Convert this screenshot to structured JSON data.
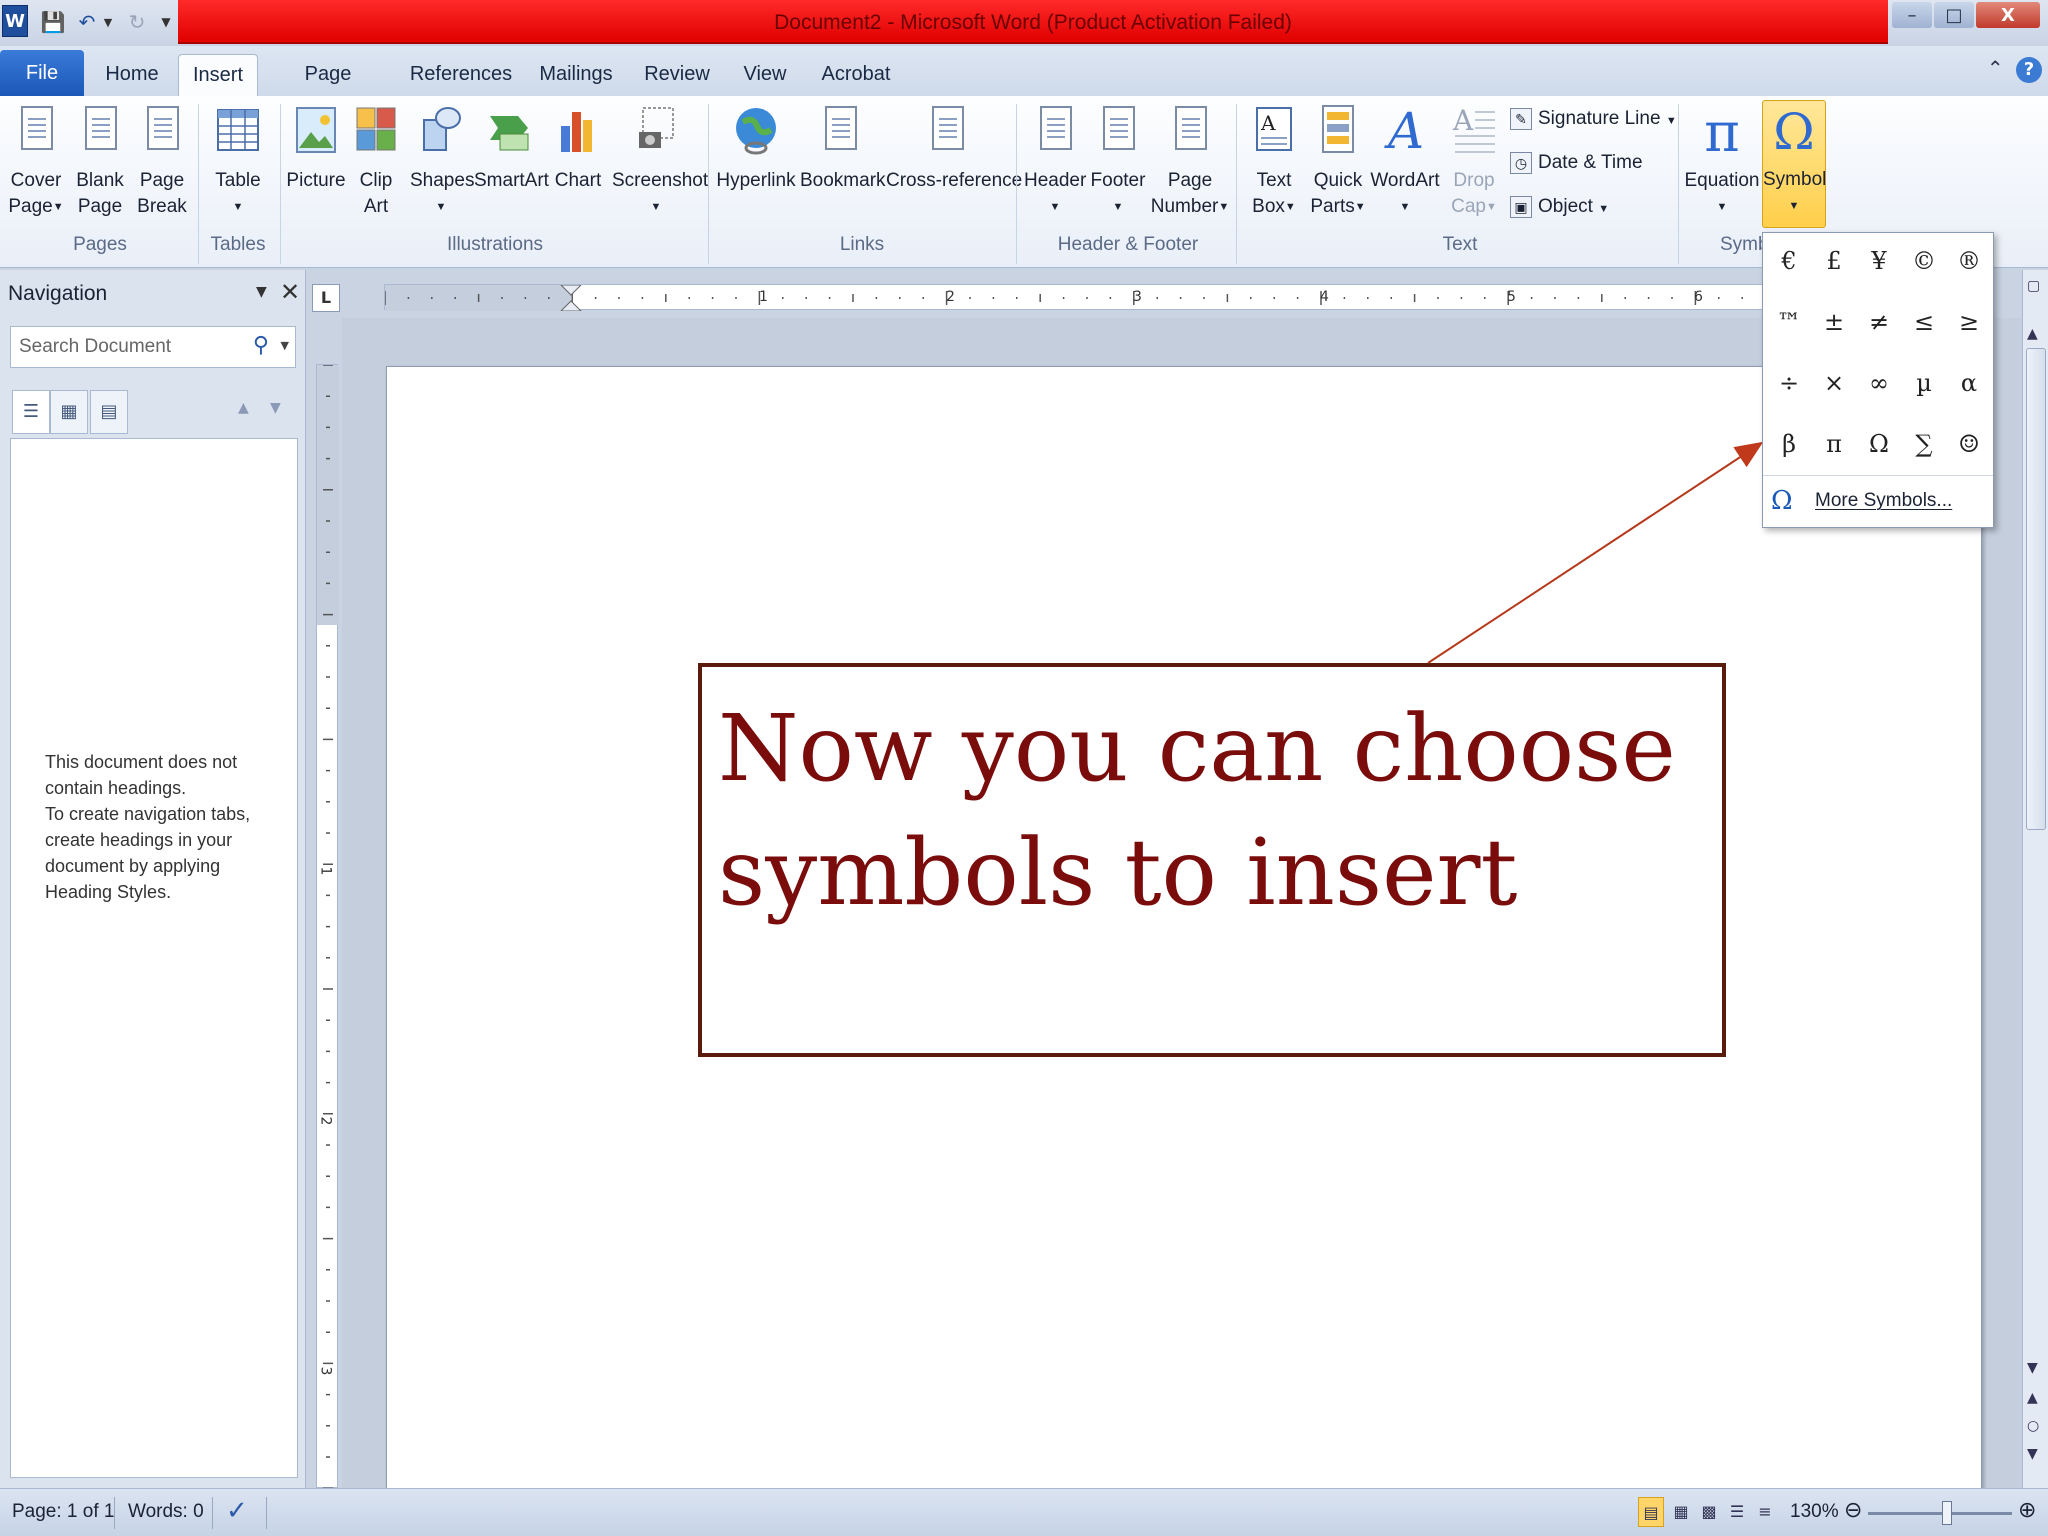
{
  "window": {
    "title": "Document2  -  Microsoft Word (Product Activation Failed)",
    "minimize": "–",
    "maximize": "□",
    "close": "X"
  },
  "qat": {
    "word_icon": "W",
    "save_icon": "save-icon",
    "undo_icon": "undo-icon",
    "redo_icon": "redo-icon"
  },
  "tabs": [
    "File",
    "Home",
    "Insert",
    "Page Layout",
    "References",
    "Mailings",
    "Review",
    "View",
    "Acrobat"
  ],
  "ribbon": {
    "pages": {
      "label": "Pages",
      "cover": "Cover",
      "cover2": "Page",
      "blank": "Blank",
      "blank2": "Page",
      "break": "Page",
      "break2": "Break"
    },
    "tables": {
      "label": "Tables",
      "table": "Table"
    },
    "illustrations": {
      "label": "Illustrations",
      "picture": "Picture",
      "clip": "Clip",
      "clip2": "Art",
      "shapes": "Shapes",
      "smartart": "SmartArt",
      "chart": "Chart",
      "screenshot": "Screenshot"
    },
    "links": {
      "label": "Links",
      "hyperlink": "Hyperlink",
      "bookmark": "Bookmark",
      "crossref": "Cross-reference"
    },
    "header_footer": {
      "label": "Header & Footer",
      "header": "Header",
      "footer": "Footer",
      "pagenum": "Page",
      "pagenum2": "Number"
    },
    "text": {
      "label": "Text",
      "textbox": "Text",
      "textbox2": "Box",
      "quickparts": "Quick",
      "quickparts2": "Parts",
      "wordart": "WordArt",
      "dropcap": "Drop",
      "dropcap2": "Cap",
      "signature": "Signature Line",
      "datetime": "Date & Time",
      "object": "Object"
    },
    "symbols": {
      "label": "Symb",
      "equation": "Equation",
      "symbol": "Symbol"
    }
  },
  "navigation": {
    "title": "Navigation",
    "search_placeholder": "Search Document",
    "msg1_line1": "This document does not",
    "msg1_line2": "contain headings.",
    "msg2_line1": "To create navigation tabs,",
    "msg2_line2": "create headings in your",
    "msg2_line3": "document by applying",
    "msg2_line4": "Heading Styles."
  },
  "ruler": {
    "corner": "L",
    "h_numbers": [
      "1",
      "2",
      "3",
      "4",
      "5",
      "6"
    ],
    "v_numbers": [
      "1",
      "2",
      "3"
    ]
  },
  "symbol_gallery": {
    "symbols": [
      "€",
      "£",
      "¥",
      "©",
      "®",
      "™",
      "±",
      "≠",
      "≤",
      "≥",
      "÷",
      "×",
      "∞",
      "µ",
      "α",
      "β",
      "π",
      "Ω",
      "∑",
      "☺"
    ],
    "more_icon": "Ω",
    "more_label": "More Symbols..."
  },
  "callout": {
    "line1": "Now you can choose",
    "line2": "symbols to insert",
    "color": "#7a0c0c",
    "border_color": "#5a1a0e"
  },
  "statusbar": {
    "page": "Page: 1 of 1",
    "words": "Words: 0",
    "zoom": "130%"
  }
}
